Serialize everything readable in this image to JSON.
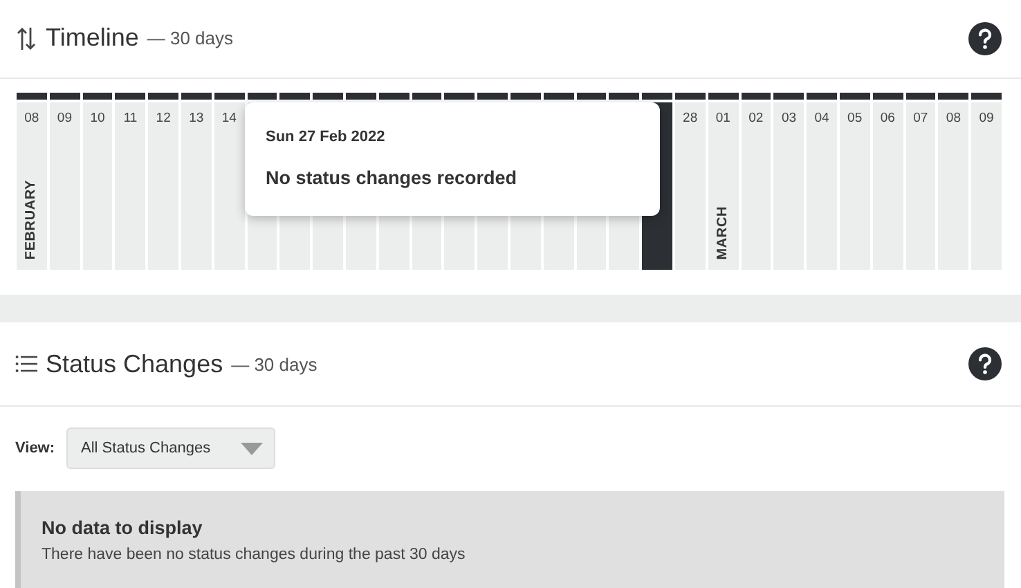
{
  "timeline": {
    "title": "Timeline",
    "subtitle": "— 30 days",
    "days": [
      {
        "label": "08",
        "month": "FEBRUARY",
        "selected": false
      },
      {
        "label": "09",
        "selected": false
      },
      {
        "label": "10",
        "selected": false
      },
      {
        "label": "11",
        "selected": false
      },
      {
        "label": "12",
        "selected": false
      },
      {
        "label": "13",
        "selected": false
      },
      {
        "label": "14",
        "selected": false
      },
      {
        "selected": false
      },
      {
        "selected": false
      },
      {
        "selected": false
      },
      {
        "selected": false
      },
      {
        "selected": false
      },
      {
        "selected": false
      },
      {
        "selected": false
      },
      {
        "selected": false
      },
      {
        "selected": false
      },
      {
        "selected": false
      },
      {
        "selected": false
      },
      {
        "selected": false
      },
      {
        "selected": true
      },
      {
        "label": "28",
        "selected": false
      },
      {
        "label": "01",
        "month": "MARCH",
        "selected": false
      },
      {
        "label": "02",
        "selected": false
      },
      {
        "label": "03",
        "selected": false
      },
      {
        "label": "04",
        "selected": false
      },
      {
        "label": "05",
        "selected": false
      },
      {
        "label": "06",
        "selected": false
      },
      {
        "label": "07",
        "selected": false
      },
      {
        "label": "08",
        "selected": false
      },
      {
        "label": "09",
        "selected": false
      }
    ],
    "tooltip": {
      "date": "Sun 27 Feb 2022",
      "message": "No status changes recorded"
    }
  },
  "status_changes": {
    "title": "Status Changes",
    "subtitle": "— 30 days",
    "view_label": "View:",
    "view_value": "All Status Changes",
    "empty": {
      "title": "No data to display",
      "message": "There have been no status changes during the past 30 days"
    }
  }
}
